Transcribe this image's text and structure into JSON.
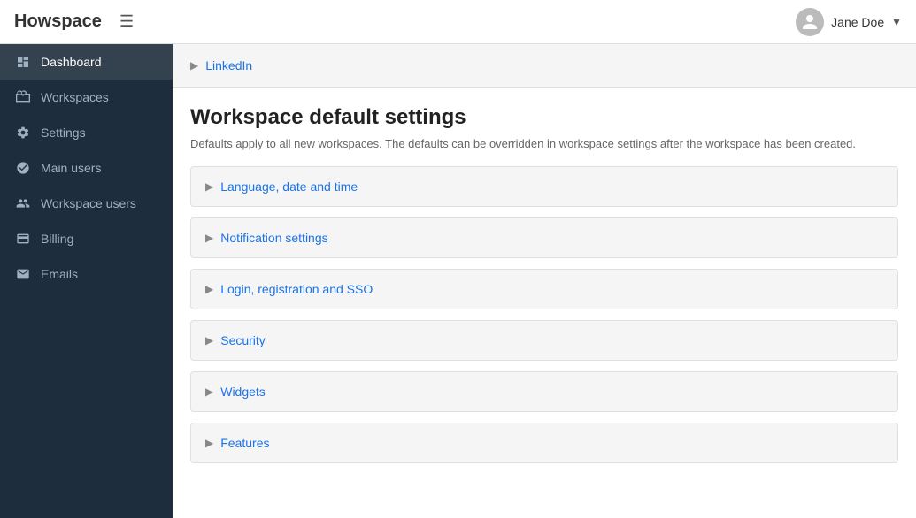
{
  "header": {
    "logo": "Howspace",
    "hamburger_label": "☰",
    "user_name": "Jane Doe",
    "dropdown_arrow": "▼"
  },
  "sidebar": {
    "items": [
      {
        "id": "dashboard",
        "label": "Dashboard",
        "active": true
      },
      {
        "id": "workspaces",
        "label": "Workspaces",
        "active": false
      },
      {
        "id": "settings",
        "label": "Settings",
        "active": false
      },
      {
        "id": "main-users",
        "label": "Main users",
        "active": false
      },
      {
        "id": "workspace-users",
        "label": "Workspace users",
        "active": false
      },
      {
        "id": "billing",
        "label": "Billing",
        "active": false
      },
      {
        "id": "emails",
        "label": "Emails",
        "active": false
      }
    ]
  },
  "main": {
    "linkedin_label": "LinkedIn",
    "section_title": "Workspace default settings",
    "section_description": "Defaults apply to all new workspaces. The defaults can be overridden in workspace settings after the workspace has been created.",
    "accordion_items": [
      {
        "id": "language",
        "label": "Language, date and time"
      },
      {
        "id": "notification",
        "label": "Notification settings"
      },
      {
        "id": "login",
        "label": "Login, registration and SSO"
      },
      {
        "id": "security",
        "label": "Security"
      },
      {
        "id": "widgets",
        "label": "Widgets"
      },
      {
        "id": "features",
        "label": "Features"
      }
    ]
  }
}
